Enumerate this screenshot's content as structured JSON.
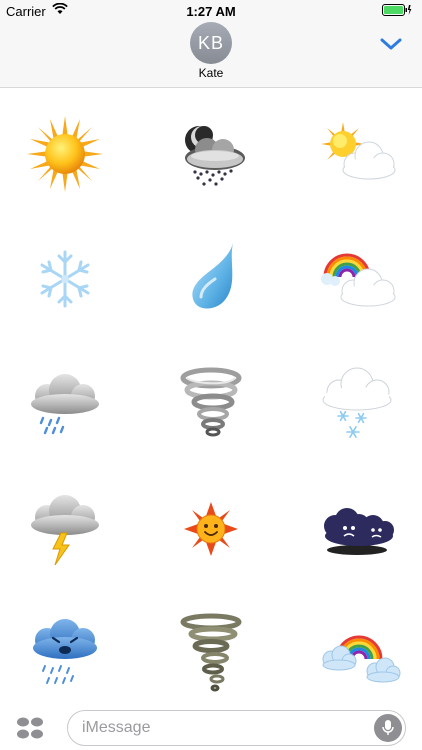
{
  "status_bar": {
    "carrier": "Carrier",
    "time": "1:27 AM"
  },
  "header": {
    "avatar_initials": "KB",
    "contact_name": "Kate",
    "collapse_icon": "chevron-down-icon"
  },
  "stickers": [
    {
      "name": "sun-sticker",
      "icon": "sun"
    },
    {
      "name": "night-storm-sticker",
      "icon": "night-hail-cloud"
    },
    {
      "name": "partly-sunny-sticker",
      "icon": "sun-cloud"
    },
    {
      "name": "snowflake-sticker",
      "icon": "snowflake"
    },
    {
      "name": "raindrop-sticker",
      "icon": "raindrop"
    },
    {
      "name": "rainbow-cloud-sticker",
      "icon": "rainbow-cloud"
    },
    {
      "name": "rain-cloud-sticker",
      "icon": "rain-cloud"
    },
    {
      "name": "whirlwind-sticker",
      "icon": "whirlwind"
    },
    {
      "name": "snow-cloud-sticker",
      "icon": "snow-cloud"
    },
    {
      "name": "thunder-cloud-sticker",
      "icon": "lightning-cloud"
    },
    {
      "name": "smiling-sun-sticker",
      "icon": "smiling-sun"
    },
    {
      "name": "sad-dark-clouds-sticker",
      "icon": "sad-dark-clouds"
    },
    {
      "name": "crying-blue-cloud-sticker",
      "icon": "crying-cloud"
    },
    {
      "name": "tornado-sticker",
      "icon": "tornado"
    },
    {
      "name": "rainbow-clouds-sticker",
      "icon": "rainbow-clouds"
    }
  ],
  "input_bar": {
    "apps_icon": "app-drawer-icon",
    "placeholder": "iMessage",
    "mic_icon": "microphone-icon"
  },
  "colors": {
    "accent": "#2f7ce0",
    "bar_background": "#f7f7f7"
  }
}
